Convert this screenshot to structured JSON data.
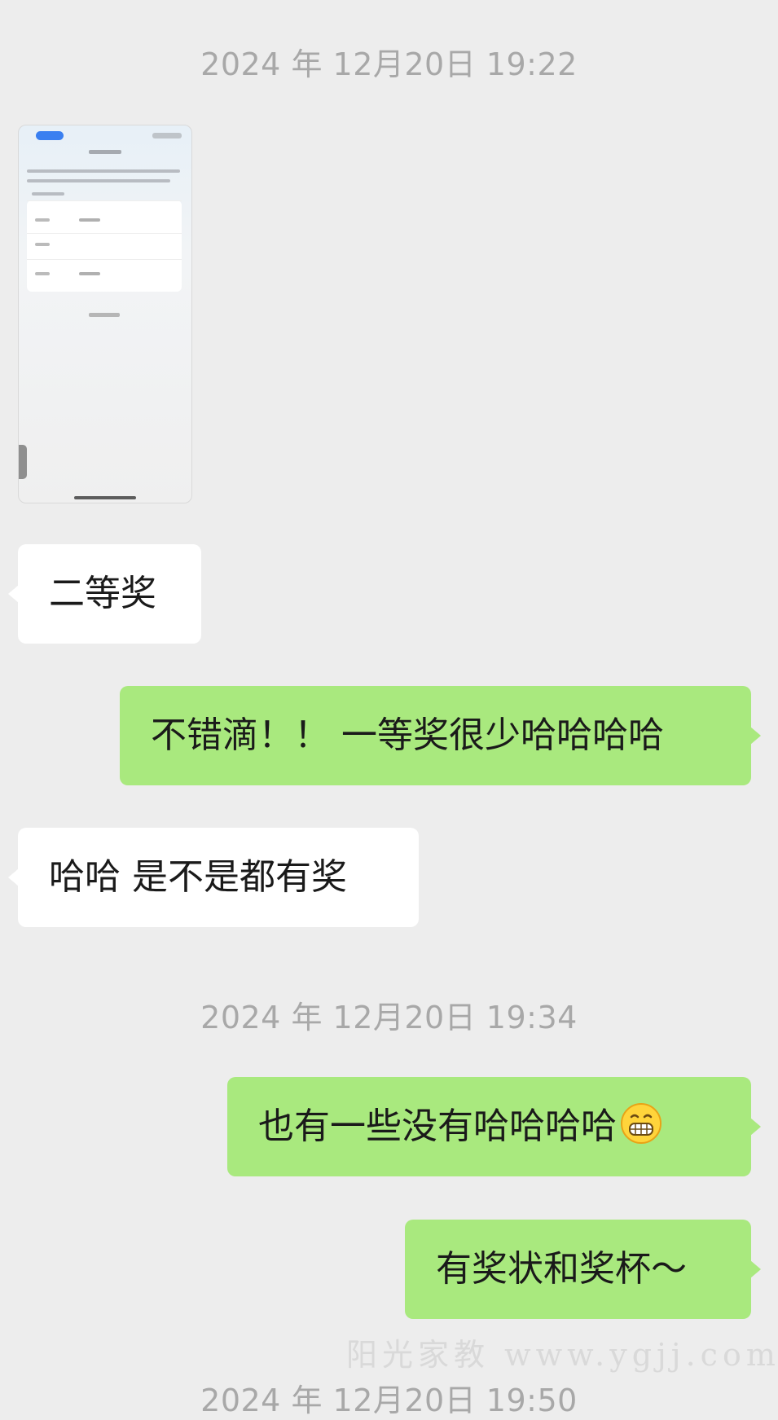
{
  "timestamps": [
    "2024 年 12月20日 19:22",
    "2024 年 12月20日 19:34",
    "2024 年 12月20日 19:50"
  ],
  "messages": [
    {
      "side": "in",
      "text": "二等奖"
    },
    {
      "side": "out",
      "text": "不错滴！！ 一等奖很少哈哈哈哈"
    },
    {
      "side": "in",
      "text": "哈哈 是不是都有奖"
    },
    {
      "side": "out",
      "text": "也有一些没有哈哈哈哈",
      "emoji": "grinning-face-emoji"
    },
    {
      "side": "out",
      "text": "有奖状和奖杯～"
    }
  ],
  "watermark": "阳光家教 www.ygjj.com",
  "colors": {
    "background": "#ededed",
    "incoming_bubble": "#ffffff",
    "outgoing_bubble": "#a9e97e",
    "timestamp_text": "#a8a8a8"
  }
}
